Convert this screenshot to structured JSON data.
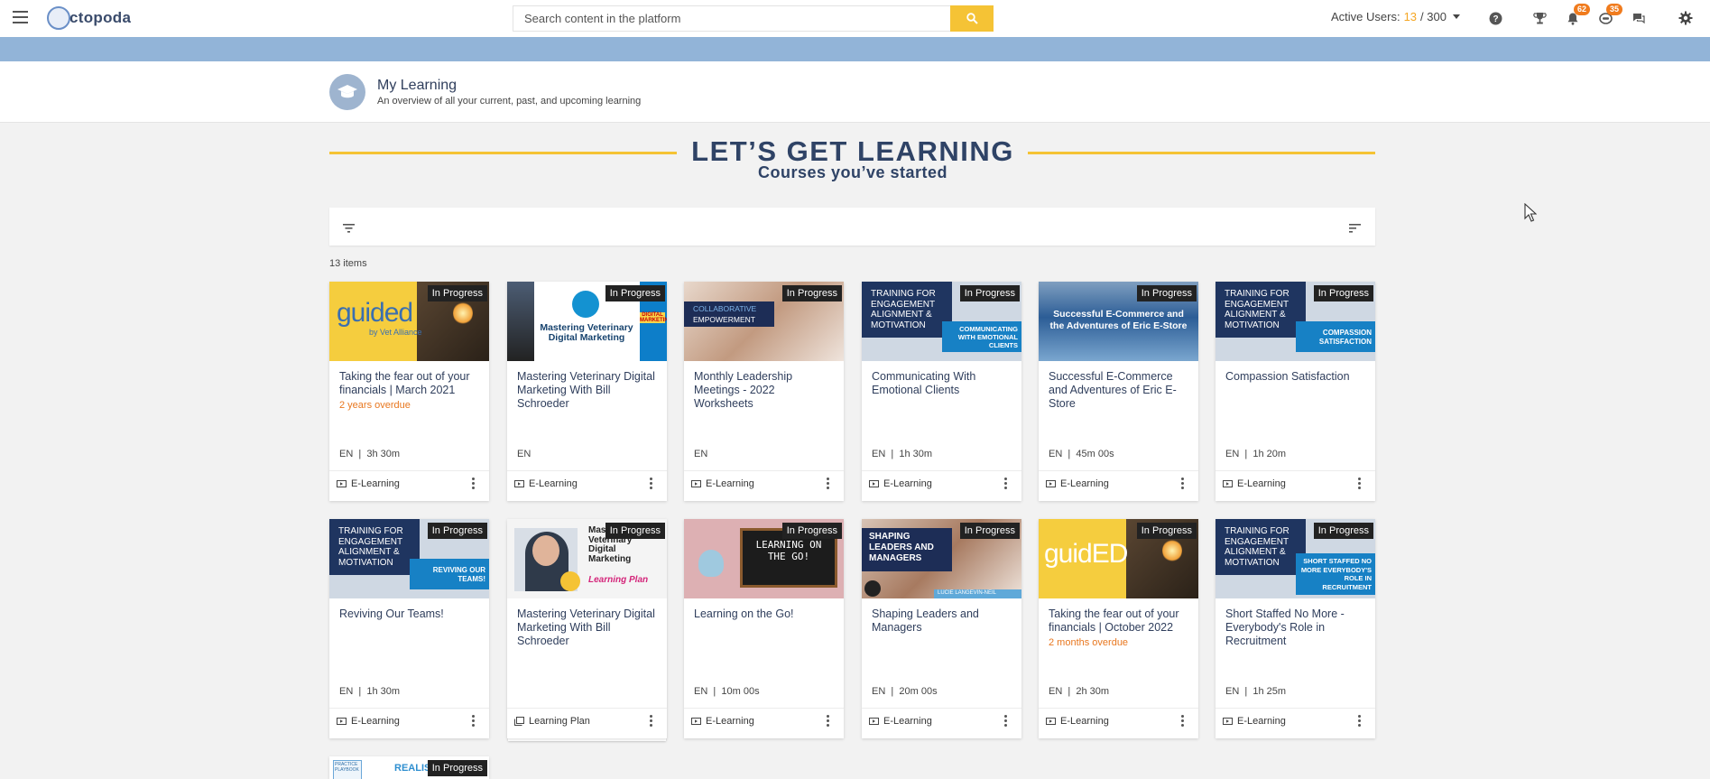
{
  "topbar": {
    "logo_text": "ctopoda",
    "search_placeholder": "Search content in the platform",
    "active_users_label": "Active Users:",
    "active_users_count": "13",
    "active_users_max": "/ 300",
    "notifications_badge": "62",
    "messages_badge": "35"
  },
  "header": {
    "title": "My Learning",
    "subtitle": "An overview of all your current, past, and upcoming learning"
  },
  "hero": {
    "title": "LET’S GET LEARNING",
    "subtitle": "Courses you’ve started"
  },
  "list": {
    "count": "13 items"
  },
  "cards": [
    {
      "status": "In Progress",
      "title": "Taking the fear out of your financials | March 2021",
      "overdue": "2 years overdue",
      "lang": "EN",
      "duration": "3h 30m",
      "type": "E-Learning",
      "thumb_text": "guided",
      "thumb_sub": "by Vet Alliance"
    },
    {
      "status": "In Progress",
      "title": "Mastering Veterinary Digital Marketing With Bill Schroeder",
      "overdue": "",
      "lang": "EN",
      "duration": "",
      "type": "E-Learning",
      "thumb_text": "Mastering Veterinary Digital Marketing",
      "thumb_sub": "DIGITAL MARKETING"
    },
    {
      "status": "In Progress",
      "title": "Monthly Leadership Meetings - 2022 Worksheets",
      "overdue": "",
      "lang": "EN",
      "duration": "",
      "type": "E-Learning",
      "thumb_text": "COLLABORATIVE",
      "thumb_sub": "EMPOWERMENT"
    },
    {
      "status": "In Progress",
      "title": "Communicating With Emotional Clients",
      "overdue": "",
      "lang": "EN",
      "duration": "1h 30m",
      "type": "E-Learning",
      "thumb_text": "TRAINING FOR ENGAGEMENT ALIGNMENT & MOTIVATION",
      "thumb_sub": "COMMUNICATING WITH EMOTIONAL CLIENTS"
    },
    {
      "status": "In Progress",
      "title": "Successful E-Commerce and Adventures of Eric E-Store",
      "overdue": "",
      "lang": "EN",
      "duration": "45m 00s",
      "type": "E-Learning",
      "thumb_text": "Successful E-Commerce and the Adventures of Eric E-Store",
      "thumb_sub": ""
    },
    {
      "status": "In Progress",
      "title": "Compassion Satisfaction",
      "overdue": "",
      "lang": "EN",
      "duration": "1h 20m",
      "type": "E-Learning",
      "thumb_text": "TRAINING FOR ENGAGEMENT ALIGNMENT & MOTIVATION",
      "thumb_sub": "COMPASSION SATISFACTION"
    },
    {
      "status": "In Progress",
      "title": "Reviving Our Teams!",
      "overdue": "",
      "lang": "EN",
      "duration": "1h 30m",
      "type": "E-Learning",
      "thumb_text": "TRAINING FOR ENGAGEMENT ALIGNMENT & MOTIVATION",
      "thumb_sub": "REVIVING OUR TEAMS!"
    },
    {
      "status": "In Progress",
      "title": "Mastering Veterinary Digital Marketing With Bill Schroeder",
      "overdue": "",
      "lang": "",
      "duration": "",
      "type": "Learning Plan",
      "thumb_text": "Mastering Veterinary Digital Marketing",
      "thumb_sub": "Learning Plan"
    },
    {
      "status": "In Progress",
      "title": "Learning on the Go!",
      "overdue": "",
      "lang": "EN",
      "duration": "10m 00s",
      "type": "E-Learning",
      "thumb_text": "LEARNING ON THE GO!",
      "thumb_sub": ""
    },
    {
      "status": "In Progress",
      "title": "Shaping Leaders and Managers",
      "overdue": "",
      "lang": "EN",
      "duration": "20m 00s",
      "type": "E-Learning",
      "thumb_text": "SHAPING LEADERS AND MANAGERS",
      "thumb_sub": "LUCIE LANGEVIN-NEIL"
    },
    {
      "status": "In Progress",
      "title": "Taking the fear out of your financials | October 2022",
      "overdue": "2 months overdue",
      "lang": "EN",
      "duration": "2h 30m",
      "type": "E-Learning",
      "thumb_text": "guidED",
      "thumb_sub": ""
    },
    {
      "status": "In Progress",
      "title": "Short Staffed No More - Everybody's Role in Recruitment",
      "overdue": "",
      "lang": "EN",
      "duration": "1h 25m",
      "type": "E-Learning",
      "thumb_text": "TRAINING FOR ENGAGEMENT ALIGNMENT & MOTIVATION",
      "thumb_sub": "SHORT STAFFED NO MORE EVERYBODY'S ROLE IN RECRUITMENT"
    },
    {
      "status": "In Progress",
      "title": "",
      "overdue": "",
      "lang": "",
      "duration": "",
      "type": "",
      "thumb_text": "REALISTIC",
      "thumb_sub": "PRACTICE PLAYBOOK"
    }
  ],
  "colors": {
    "accent": "#f5c335",
    "navy": "#2f4366",
    "band": "#92b4d8",
    "overdue": "#e8771f",
    "badge": "#f07b1d"
  },
  "icons": [
    "menu-icon",
    "search-icon",
    "help-icon",
    "trophy-icon",
    "bell-icon",
    "messages-icon",
    "chat-icon",
    "gear-icon",
    "graduation-cap-icon",
    "filter-icon",
    "sort-icon",
    "elearning-icon",
    "learning-plan-icon",
    "kebab-icon"
  ]
}
